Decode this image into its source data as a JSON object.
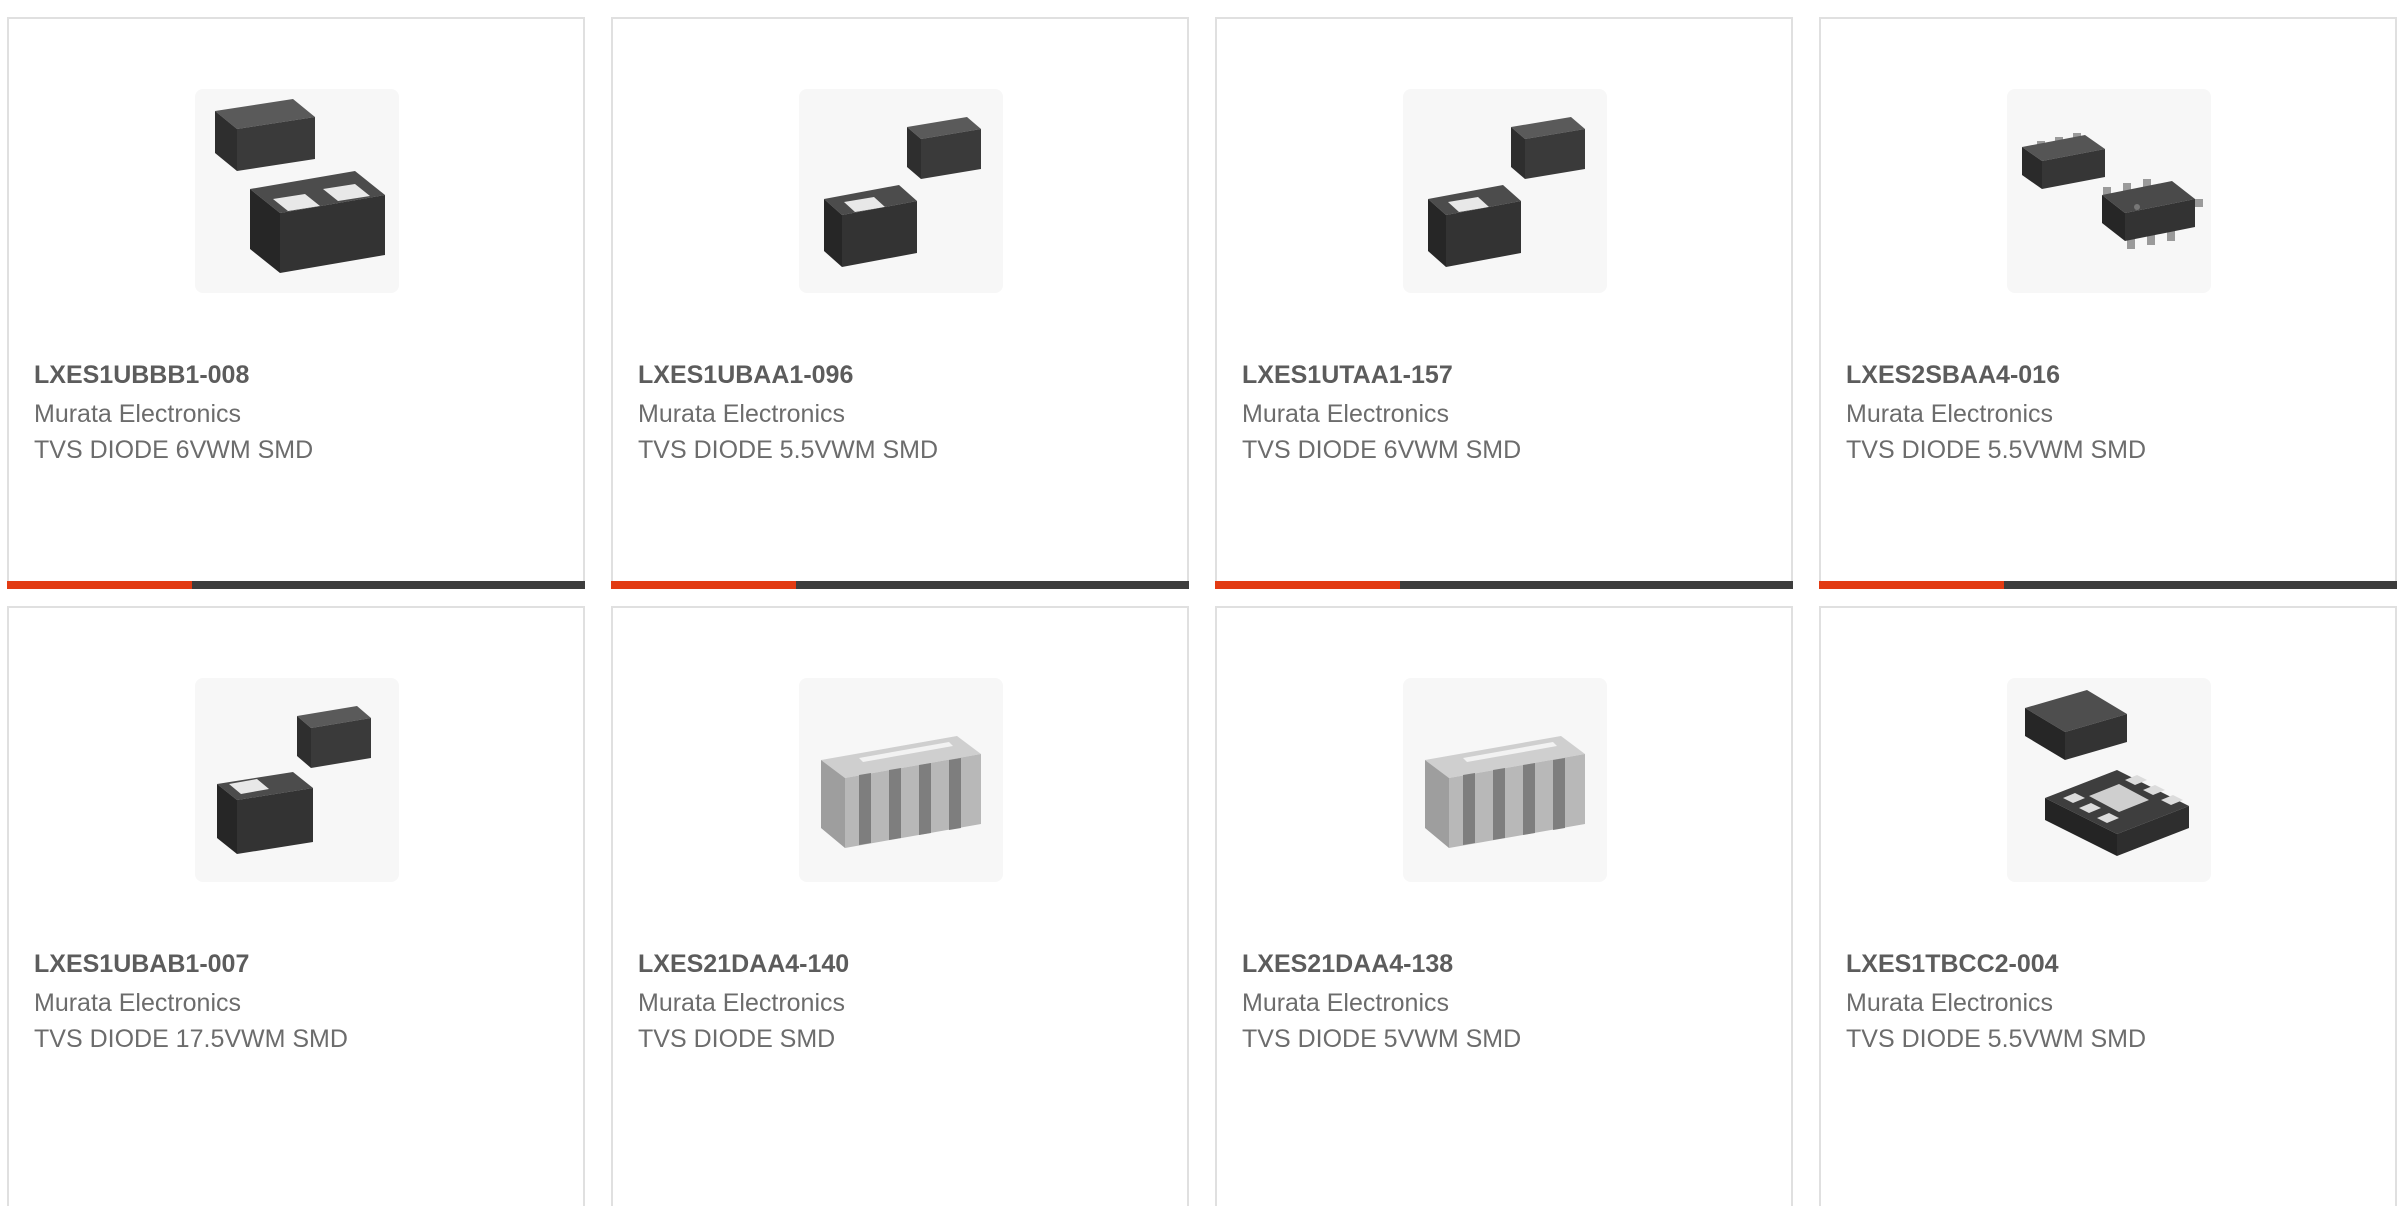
{
  "accent_color": "#e23b13",
  "bar_track_color": "#3d3d3d",
  "products": [
    {
      "part_number": "LXES1UBBB1-008",
      "manufacturer": "Murata Electronics",
      "description": "TVS DIODE 6VWM SMD",
      "image_icon": "two-chip-package-icon",
      "progress": 0.32
    },
    {
      "part_number": "LXES1UBAA1-096",
      "manufacturer": "Murata Electronics",
      "description": "TVS DIODE 5.5VWM SMD",
      "image_icon": "two-chip-package-icon",
      "progress": 0.32
    },
    {
      "part_number": "LXES1UTAA1-157",
      "manufacturer": "Murata Electronics",
      "description": "TVS DIODE 6VWM SMD",
      "image_icon": "two-chip-package-icon",
      "progress": 0.32
    },
    {
      "part_number": "LXES2SBAA4-016",
      "manufacturer": "Murata Electronics",
      "description": "TVS DIODE 5.5VWM SMD",
      "image_icon": "sot-package-icon",
      "progress": 0.32
    },
    {
      "part_number": "LXES1UBAB1-007",
      "manufacturer": "Murata Electronics",
      "description": "TVS DIODE 17.5VWM SMD",
      "image_icon": "two-chip-package-icon",
      "progress": null
    },
    {
      "part_number": "LXES21DAA4-140",
      "manufacturer": "Murata Electronics",
      "description": "TVS DIODE SMD",
      "image_icon": "array-chip-icon",
      "progress": null
    },
    {
      "part_number": "LXES21DAA4-138",
      "manufacturer": "Murata Electronics",
      "description": "TVS DIODE 5VWM SMD",
      "image_icon": "array-chip-icon",
      "progress": null
    },
    {
      "part_number": "LXES1TBCC2-004",
      "manufacturer": "Murata Electronics",
      "description": "TVS DIODE 5.5VWM SMD",
      "image_icon": "dfn-package-icon",
      "progress": null
    }
  ]
}
